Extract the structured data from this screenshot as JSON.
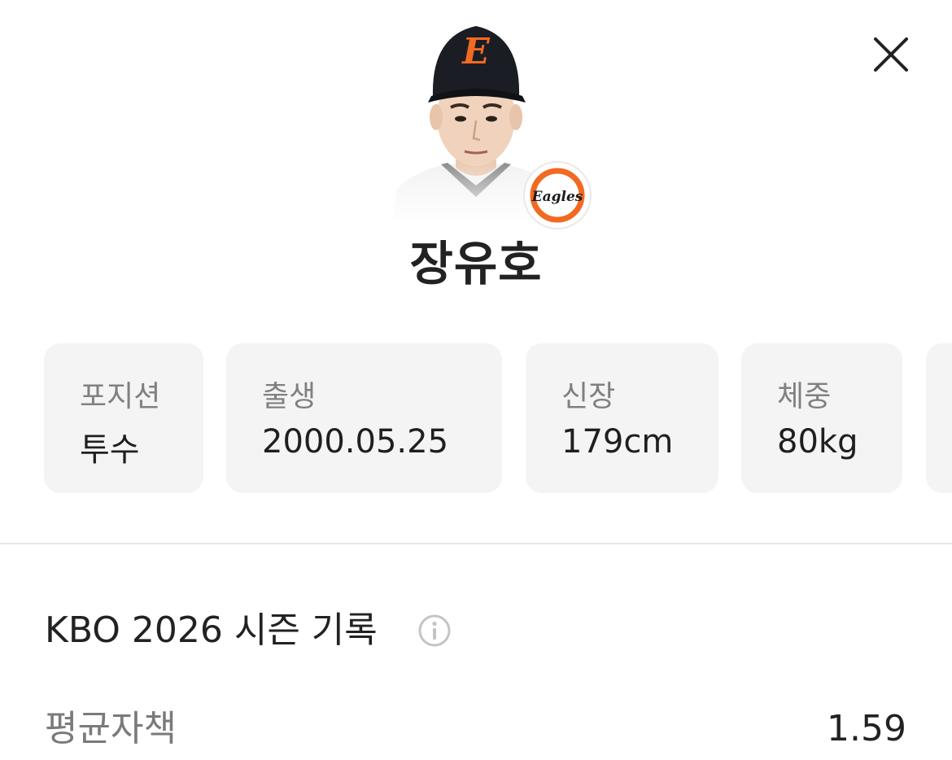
{
  "header": {
    "close_icon": "close-icon"
  },
  "player": {
    "name": "장유호",
    "photo_icon": "player-photo",
    "team_logo_text": "Eagles",
    "cap_letter": "E"
  },
  "info_cards": [
    {
      "label": "포지션",
      "value": "투수"
    },
    {
      "label": "출생",
      "value": "2000.05.25"
    },
    {
      "label": "신장",
      "value": "179cm"
    },
    {
      "label": "체중",
      "value": "80kg"
    }
  ],
  "season": {
    "title": "KBO 2026 시즌 기록",
    "info_icon": "info-icon",
    "stats": [
      {
        "label": "평균자책",
        "value": "1.59"
      }
    ]
  },
  "colors": {
    "accent_orange": "#f26a21",
    "card_bg": "#f4f4f4",
    "muted_text": "#808080"
  }
}
